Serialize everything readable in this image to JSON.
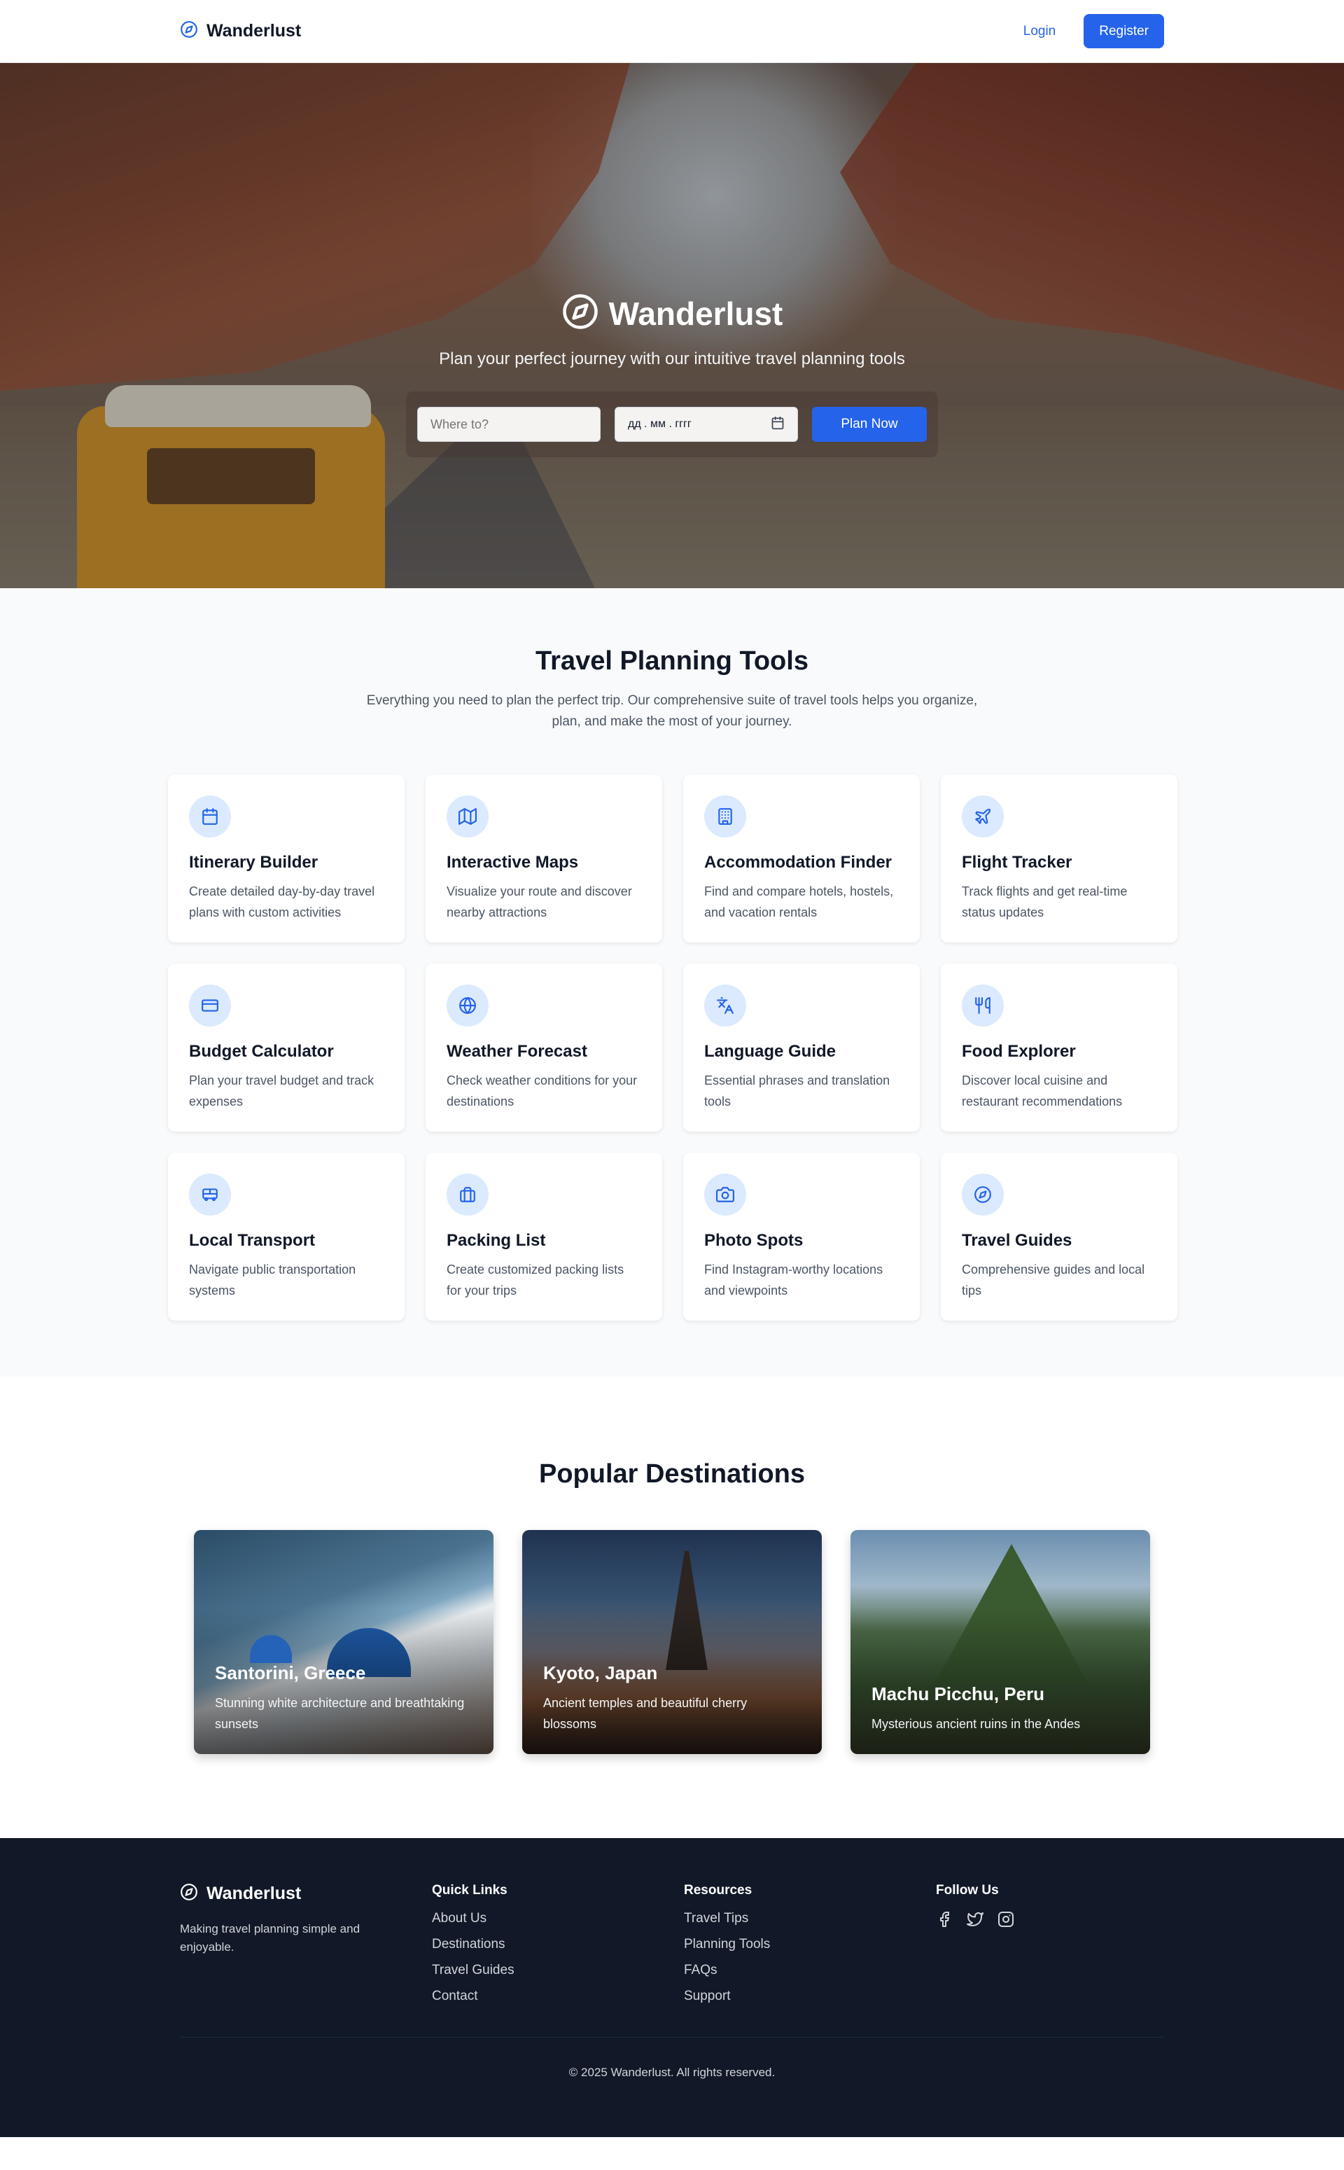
{
  "brand": {
    "name": "Wanderlust",
    "icon": "compass-icon"
  },
  "nav": {
    "login": "Login",
    "register": "Register"
  },
  "hero": {
    "title": "Wanderlust",
    "subtitle": "Plan your perfect journey with our intuitive travel planning tools",
    "destination_placeholder": "Where to?",
    "date_value": "дд . мм . гггг",
    "plan_button": "Plan Now"
  },
  "tools": {
    "title": "Travel Planning Tools",
    "subtitle": "Everything you need to plan the perfect trip. Our comprehensive suite of travel tools helps you organize, plan, and make the most of your journey.",
    "items": [
      {
        "icon": "calendar-icon",
        "title": "Itinerary Builder",
        "desc": "Create detailed day-by-day travel plans with custom activities"
      },
      {
        "icon": "map-icon",
        "title": "Interactive Maps",
        "desc": "Visualize your route and discover nearby attractions"
      },
      {
        "icon": "building-icon",
        "title": "Accommodation Finder",
        "desc": "Find and compare hotels, hostels, and vacation rentals"
      },
      {
        "icon": "plane-icon",
        "title": "Flight Tracker",
        "desc": "Track flights and get real-time status updates"
      },
      {
        "icon": "credit-card-icon",
        "title": "Budget Calculator",
        "desc": "Plan your travel budget and track expenses"
      },
      {
        "icon": "globe-icon",
        "title": "Weather Forecast",
        "desc": "Check weather conditions for your destinations"
      },
      {
        "icon": "translate-icon",
        "title": "Language Guide",
        "desc": "Essential phrases and translation tools"
      },
      {
        "icon": "utensils-icon",
        "title": "Food Explorer",
        "desc": "Discover local cuisine and restaurant recommendations"
      },
      {
        "icon": "bus-icon",
        "title": "Local Transport",
        "desc": "Navigate public transportation systems"
      },
      {
        "icon": "briefcase-icon",
        "title": "Packing List",
        "desc": "Create customized packing lists for your trips"
      },
      {
        "icon": "camera-icon",
        "title": "Photo Spots",
        "desc": "Find Instagram-worthy locations and viewpoints"
      },
      {
        "icon": "compass-icon",
        "title": "Travel Guides",
        "desc": "Comprehensive guides and local tips"
      }
    ]
  },
  "destinations": {
    "title": "Popular Destinations",
    "items": [
      {
        "name": "Santorini, Greece",
        "desc": "Stunning white architecture and breathtaking sunsets"
      },
      {
        "name": "Kyoto, Japan",
        "desc": "Ancient temples and beautiful cherry blossoms"
      },
      {
        "name": "Machu Picchu, Peru",
        "desc": "Mysterious ancient ruins in the Andes"
      }
    ]
  },
  "footer": {
    "tagline": "Making travel planning simple and enjoyable.",
    "quick_links": {
      "title": "Quick Links",
      "items": [
        "About Us",
        "Destinations",
        "Travel Guides",
        "Contact"
      ]
    },
    "resources": {
      "title": "Resources",
      "items": [
        "Travel Tips",
        "Planning Tools",
        "FAQs",
        "Support"
      ]
    },
    "follow": {
      "title": "Follow Us",
      "icons": [
        "facebook-icon",
        "twitter-icon",
        "instagram-icon"
      ]
    },
    "copyright": "© 2025 Wanderlust. All rights reserved."
  },
  "colors": {
    "accent": "#2563eb",
    "icon_bg": "#dbeafe",
    "footer_bg": "#111827",
    "tools_bg": "#f9fafb"
  }
}
